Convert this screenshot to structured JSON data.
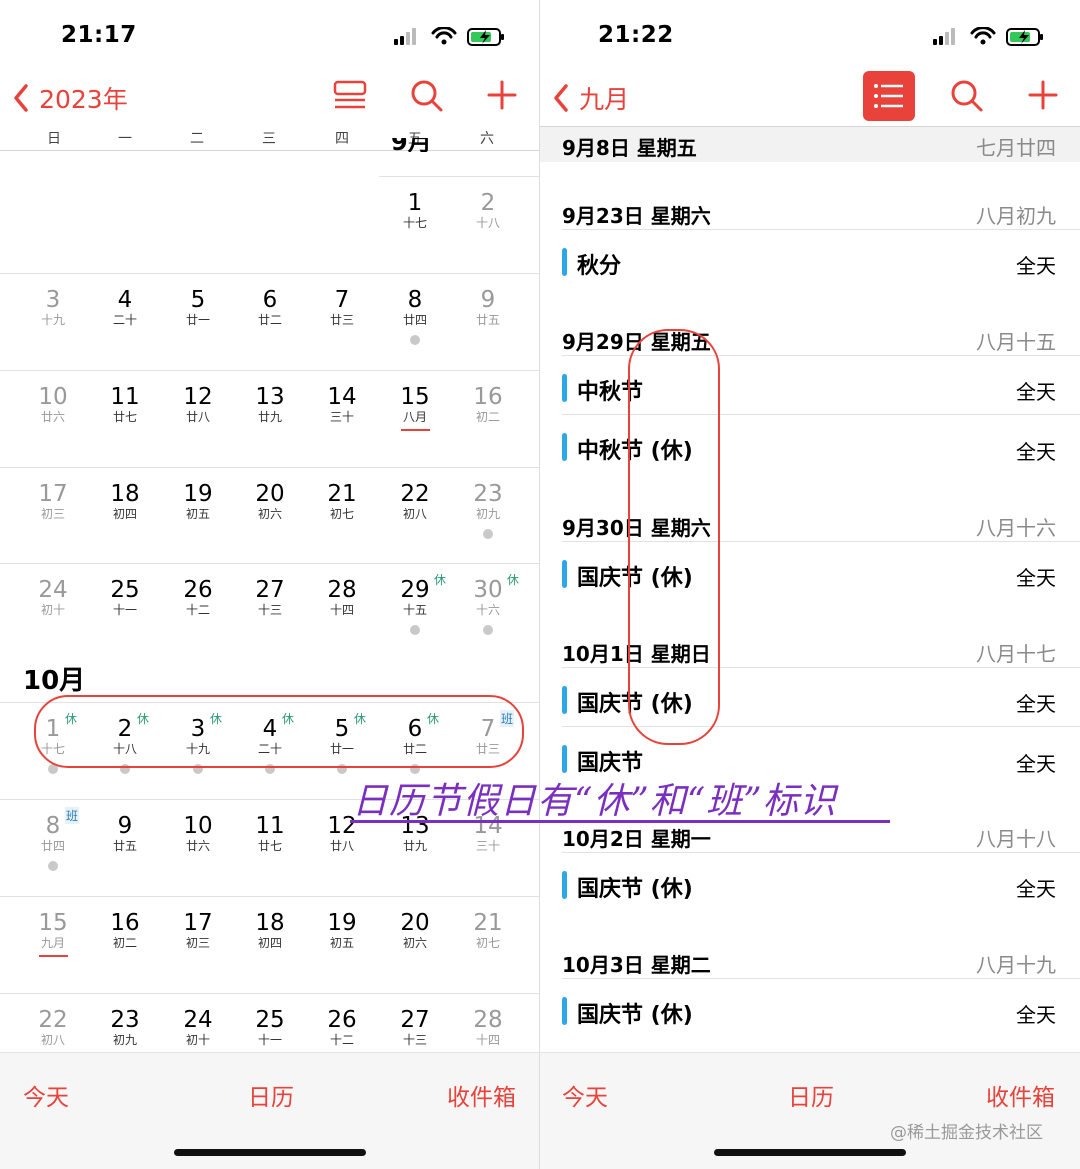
{
  "left": {
    "status_time": "21:17",
    "back_label": "2023年",
    "weekdays": [
      "日",
      "一",
      "二",
      "三",
      "四",
      "五",
      "六"
    ],
    "sept_label": "9月",
    "oct_label": "10月",
    "sep_rows": [
      [
        {
          "d": "1",
          "l": "十七"
        },
        {
          "d": "2",
          "l": "十八",
          "wk": true
        }
      ],
      [
        {
          "d": "3",
          "l": "十九",
          "wk": true
        },
        {
          "d": "4",
          "l": "二十"
        },
        {
          "d": "5",
          "l": "廿一"
        },
        {
          "d": "6",
          "l": "廿二"
        },
        {
          "d": "7",
          "l": "廿三"
        },
        {
          "d": "8",
          "l": "廿四",
          "dot": true
        },
        {
          "d": "9",
          "l": "廿五",
          "wk": true
        }
      ],
      [
        {
          "d": "10",
          "l": "廿六",
          "wk": true
        },
        {
          "d": "11",
          "l": "廿七"
        },
        {
          "d": "12",
          "l": "廿八"
        },
        {
          "d": "13",
          "l": "廿九"
        },
        {
          "d": "14",
          "l": "三十"
        },
        {
          "d": "15",
          "l": "八月",
          "ul": true
        },
        {
          "d": "16",
          "l": "初二",
          "wk": true
        }
      ],
      [
        {
          "d": "17",
          "l": "初三",
          "wk": true
        },
        {
          "d": "18",
          "l": "初四"
        },
        {
          "d": "19",
          "l": "初五"
        },
        {
          "d": "20",
          "l": "初六"
        },
        {
          "d": "21",
          "l": "初七"
        },
        {
          "d": "22",
          "l": "初八"
        },
        {
          "d": "23",
          "l": "初九",
          "wk": true,
          "dot": true
        }
      ],
      [
        {
          "d": "24",
          "l": "初十",
          "wk": true
        },
        {
          "d": "25",
          "l": "十一"
        },
        {
          "d": "26",
          "l": "十二"
        },
        {
          "d": "27",
          "l": "十三"
        },
        {
          "d": "28",
          "l": "十四"
        },
        {
          "d": "29",
          "l": "十五",
          "badge": "休",
          "dot": true
        },
        {
          "d": "30",
          "l": "十六",
          "wk": true,
          "badge": "休",
          "dot": true
        }
      ]
    ],
    "oct_rows": [
      [
        {
          "d": "1",
          "l": "十七",
          "wk": true,
          "badge": "休",
          "dot": true
        },
        {
          "d": "2",
          "l": "十八",
          "badge": "休",
          "dot": true
        },
        {
          "d": "3",
          "l": "十九",
          "badge": "休",
          "dot": true
        },
        {
          "d": "4",
          "l": "二十",
          "badge": "休",
          "dot": true
        },
        {
          "d": "5",
          "l": "廿一",
          "badge": "休",
          "dot": true
        },
        {
          "d": "6",
          "l": "廿二",
          "badge": "休",
          "dot": true
        },
        {
          "d": "7",
          "l": "廿三",
          "wk": true,
          "badge": "班"
        }
      ],
      [
        {
          "d": "8",
          "l": "廿四",
          "wk": true,
          "badge": "班",
          "dot": true
        },
        {
          "d": "9",
          "l": "廿五"
        },
        {
          "d": "10",
          "l": "廿六"
        },
        {
          "d": "11",
          "l": "廿七"
        },
        {
          "d": "12",
          "l": "廿八"
        },
        {
          "d": "13",
          "l": "廿九"
        },
        {
          "d": "14",
          "l": "三十",
          "wk": true
        }
      ],
      [
        {
          "d": "15",
          "l": "九月",
          "wk": true,
          "ul": true
        },
        {
          "d": "16",
          "l": "初二"
        },
        {
          "d": "17",
          "l": "初三"
        },
        {
          "d": "18",
          "l": "初四"
        },
        {
          "d": "19",
          "l": "初五"
        },
        {
          "d": "20",
          "l": "初六"
        },
        {
          "d": "21",
          "l": "初七",
          "wk": true
        }
      ],
      [
        {
          "d": "22",
          "l": "初八",
          "wk": true
        },
        {
          "d": "23",
          "l": "初九"
        },
        {
          "d": "24",
          "l": "初十"
        },
        {
          "d": "25",
          "l": "十一"
        },
        {
          "d": "26",
          "l": "十二"
        },
        {
          "d": "27",
          "l": "十三"
        },
        {
          "d": "28",
          "l": "十四",
          "wk": true
        }
      ]
    ],
    "tabs": {
      "today": "今天",
      "calendars": "日历",
      "inbox": "收件箱"
    }
  },
  "right": {
    "status_time": "21:22",
    "back_label": "九月",
    "sections": [
      {
        "date": "9月8日 星期五",
        "lunar": "七月廿四",
        "events": []
      },
      {
        "date": "9月23日 星期六",
        "lunar": "八月初九",
        "events": [
          {
            "title": "秋分",
            "time": "全天"
          }
        ]
      },
      {
        "date": "9月29日 星期五",
        "lunar": "八月十五",
        "events": [
          {
            "title": "中秋节",
            "time": "全天"
          },
          {
            "title": "中秋节 (休)",
            "time": "全天"
          }
        ]
      },
      {
        "date": "9月30日 星期六",
        "lunar": "八月十六",
        "events": [
          {
            "title": "国庆节 (休)",
            "time": "全天"
          }
        ]
      },
      {
        "date": "10月1日 星期日",
        "lunar": "八月十七",
        "events": [
          {
            "title": "国庆节 (休)",
            "time": "全天"
          },
          {
            "title": "国庆节",
            "time": "全天"
          }
        ]
      },
      {
        "date": "10月2日 星期一",
        "lunar": "八月十八",
        "events": [
          {
            "title": "国庆节 (休)",
            "time": "全天"
          }
        ]
      },
      {
        "date": "10月3日 星期二",
        "lunar": "八月十九",
        "events": [
          {
            "title": "国庆节 (休)",
            "time": "全天"
          }
        ]
      }
    ],
    "tabs": {
      "today": "今天",
      "calendars": "日历",
      "inbox": "收件箱"
    },
    "watermark": "@稀土掘金技术社区"
  },
  "annotation_text": "日历节假日有“休”和“班”标识",
  "colors": {
    "accent": "#e8423a",
    "event_bar": "#2ea7e8",
    "rest_badge": "#2d9a76",
    "work_badge": "#2a7db5",
    "annotation": "#7b2fbf"
  }
}
